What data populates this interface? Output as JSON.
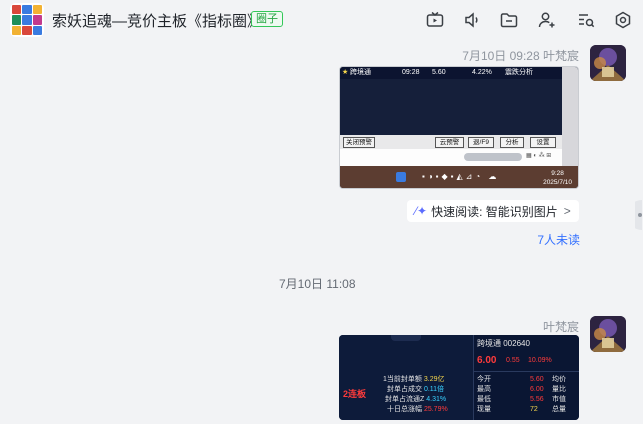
{
  "header": {
    "title": "索妖追魂—竞价主板《指标圈》",
    "tag": "圈子",
    "icons": [
      "live-tv-icon",
      "speaker-icon",
      "folder-icon",
      "add-member-icon",
      "search-list-icon",
      "settings-icon"
    ]
  },
  "messages": [
    {
      "timestamp_sender": "7月10日 09:28  叶梵宸",
      "screenshot": {
        "top_row": [
          "跨境通",
          "09:28",
          "5.60",
          "4.22%",
          "震跌分析"
        ],
        "buttons": [
          "关闭预警",
          "云预警",
          "退/F9",
          "分析",
          "设置"
        ],
        "clock_time": "9:28",
        "clock_date": "2025/7/10"
      },
      "quick_read_label": "快速阅读: 智能识别图片",
      "quick_read_chevron": ">",
      "unread_label": "7人未读"
    },
    {
      "divider_time": "7月10日 11:08",
      "sender": "叶梵宸",
      "screenshot": {
        "board_label": "2连板",
        "stats": [
          {
            "label": "1当前封单额",
            "value": "3.29亿"
          },
          {
            "label": "封单占成交",
            "value": "0.11倍"
          },
          {
            "label": "封单占流通Z",
            "value": "4.31%"
          },
          {
            "label": "十日总涨幅",
            "value": "25.79%"
          }
        ],
        "stock_name": "跨境通",
        "stock_code": "002640",
        "price": "6.00",
        "change": "0.55",
        "change_pct": "10.09%",
        "quote_rows": [
          {
            "label": "今开",
            "value": "5.60",
            "right": "均价"
          },
          {
            "label": "最高",
            "value": "6.00",
            "right": "量比"
          },
          {
            "label": "最低",
            "value": "5.56",
            "right": "市值"
          },
          {
            "label": "现量",
            "value": "72",
            "right": "总量"
          }
        ]
      }
    }
  ],
  "colors": {
    "accent": "#3370ff",
    "tag_green": "#34c759",
    "background": "#f2f3f5"
  }
}
